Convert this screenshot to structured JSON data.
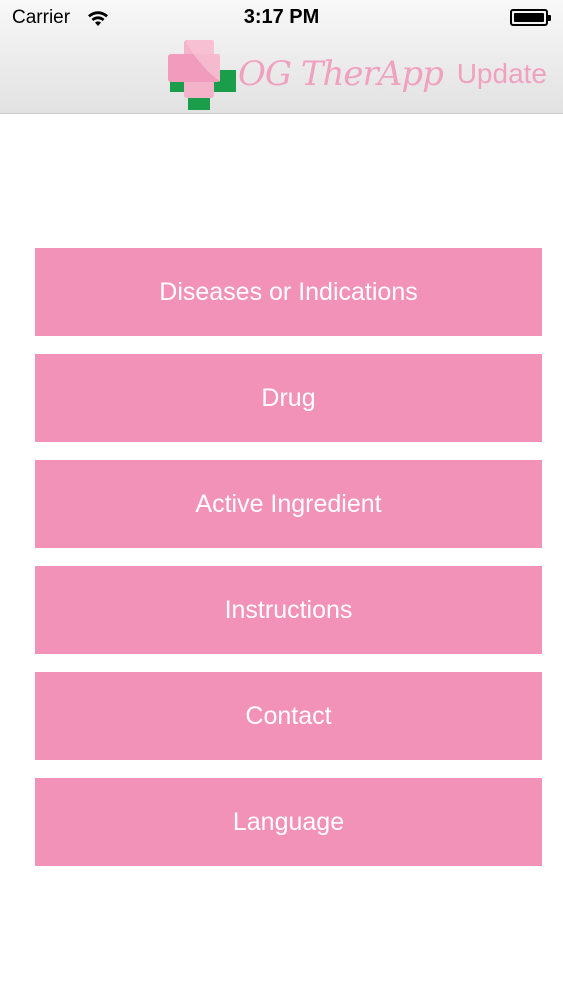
{
  "status_bar": {
    "carrier": "Carrier",
    "time": "3:17 PM",
    "wifi_icon": "wifi-icon",
    "battery_icon": "battery-icon"
  },
  "nav": {
    "logo_text": "OG TherApp",
    "logo_icon": "medical-cross-icon",
    "update_label": "Update",
    "colors": {
      "logo_pink": "#f0a1c0",
      "logo_green": "#1a9e4a"
    }
  },
  "menu": {
    "items": [
      {
        "label": "Diseases or Indications"
      },
      {
        "label": "Drug"
      },
      {
        "label": "Active Ingredient"
      },
      {
        "label": "Instructions"
      },
      {
        "label": "Contact"
      },
      {
        "label": "Language"
      }
    ],
    "button_color": "#f292b9"
  }
}
